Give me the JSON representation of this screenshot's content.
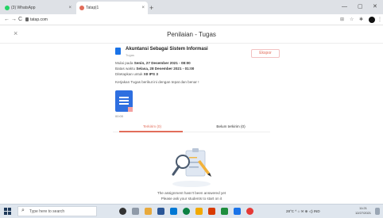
{
  "browser": {
    "tabs": [
      {
        "title": "(3) WhatsApp",
        "close": "×"
      },
      {
        "title": "Tatap|1",
        "close": "×"
      }
    ],
    "new_tab": "+",
    "window_controls": {
      "minimize": "—",
      "maximize": "▢",
      "close": "✕"
    },
    "url": "tatap.com",
    "nav": {
      "back": "←",
      "forward": "→",
      "reload": "C"
    }
  },
  "app": {
    "close": "×",
    "page_title": "Penilaian - Tugas"
  },
  "assignment": {
    "title": "Akuntansi Sebagai Sistem Informasi",
    "subtitle": "Tugas",
    "submit_label": "Ekspor",
    "meta": [
      {
        "label": "Mulai pada ",
        "value": "Senin, 27 Desember 2021 - 08:00"
      },
      {
        "label": "Batas waktu ",
        "value": "Selasa, 28 Desember 2021 - 01:00"
      },
      {
        "label": "Ditetapkan untuk ",
        "value": "XII IPS 3"
      }
    ],
    "instruction": "Kerjakan Tugas berikut ini dengan tepat dan benar !",
    "attachment_name": "00:00"
  },
  "tabs": {
    "submitted": "Terkirim (0)",
    "not_submitted": "Belum terkirim (0)"
  },
  "empty_state": {
    "line1": "The assignment hasn't been answered yet",
    "line2": "Please ask your students to start on it"
  },
  "taskbar": {
    "search_placeholder": "Type here to search",
    "tray_text": "28°C  ^  ⌂ ✉ ⊕ ◁) IND",
    "time": "11:21",
    "date": "12/27/2021"
  },
  "colors": {
    "accent": "#e26d5a",
    "doc_blue": "#2e6fe0"
  }
}
